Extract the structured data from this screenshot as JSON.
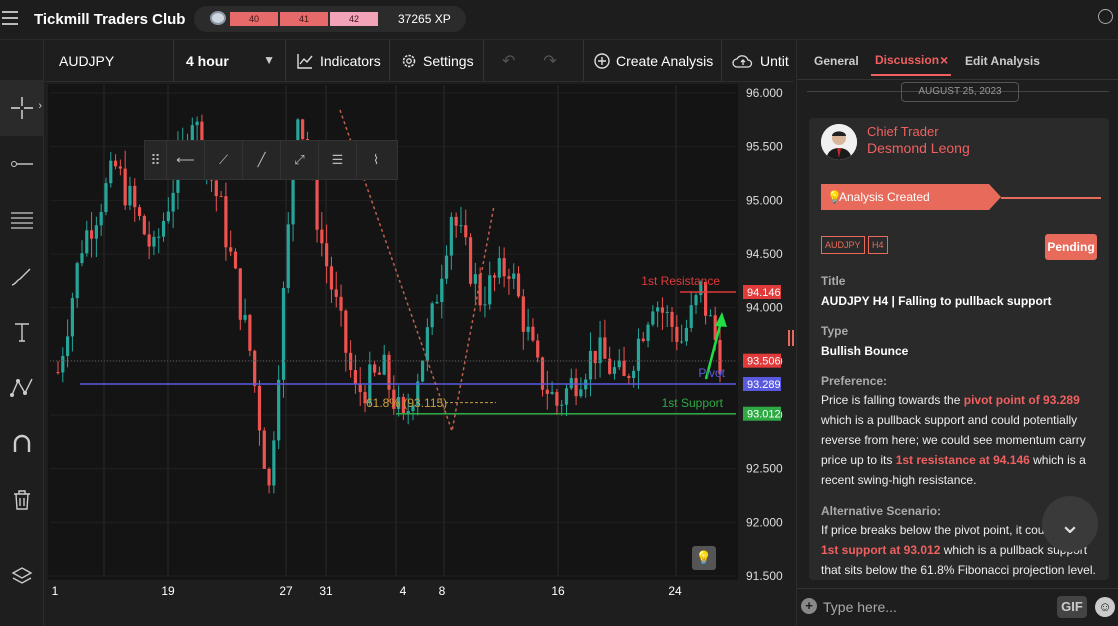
{
  "app": {
    "title": "Tickmill Traders Club"
  },
  "xp": {
    "levels": [
      "40",
      "41",
      "42"
    ],
    "value": "37265 XP"
  },
  "toolbar": {
    "symbol": "AUDJPY",
    "timeframe": "4 hour",
    "indicators": "Indicators",
    "settings": "Settings",
    "create": "Create Analysis",
    "untitled": "Untit"
  },
  "chart": {
    "y_ticks": [
      "96.000",
      "95.500",
      "95.000",
      "94.500",
      "94.000",
      "93.500",
      "93.000",
      "92.500",
      "92.000",
      "91.500"
    ],
    "x_ticks": [
      "1",
      "19",
      "27",
      "31",
      "4",
      "8",
      "16",
      "24"
    ],
    "labels": {
      "resistance": "1st Resistance",
      "pivot": "Pivot",
      "support": "1st Support",
      "fib": "61.8% (93.115)"
    },
    "price_tags": {
      "resistance": "94.146",
      "current": "93.506",
      "pivot": "93.289",
      "support": "93.012"
    },
    "colors": {
      "resistance": "#e03a3a",
      "pivot": "#5a5ae0",
      "support": "#2eaa44",
      "bull": "#26a69a",
      "bear": "#ef5350"
    }
  },
  "chart_data": {
    "type": "candlestick",
    "symbol": "AUDJPY",
    "timeframe": "4 hour",
    "ylim": [
      91.5,
      96.0
    ],
    "levels": {
      "first_resistance": 94.146,
      "pivot": 93.289,
      "first_support": 93.012,
      "fibonacci_61_8": 93.115
    },
    "current_price": 93.506,
    "path": [
      [
        0,
        93.4
      ],
      [
        5,
        94.6
      ],
      [
        12,
        95.3
      ],
      [
        20,
        94.5
      ],
      [
        28,
        95.8
      ],
      [
        34,
        94.9
      ],
      [
        40,
        93.6
      ],
      [
        44,
        92.3
      ],
      [
        50,
        95.9
      ],
      [
        55,
        94.6
      ],
      [
        62,
        93.2
      ],
      [
        68,
        93.4
      ],
      [
        72,
        92.9
      ],
      [
        78,
        93.9
      ],
      [
        82,
        94.9
      ],
      [
        88,
        94.1
      ],
      [
        94,
        94.4
      ],
      [
        100,
        93.4
      ],
      [
        104,
        93.1
      ],
      [
        112,
        93.6
      ],
      [
        118,
        93.3
      ],
      [
        124,
        94.1
      ],
      [
        130,
        93.7
      ],
      [
        134,
        94.15
      ],
      [
        138,
        93.55
      ]
    ]
  },
  "panel": {
    "tabs": [
      "General",
      "Discussion",
      "Edit Analysis"
    ],
    "tab_close": "×",
    "date": "AUGUST 25, 2023",
    "author_role": "Chief Trader",
    "author_name": "Desmond Leong",
    "status_line": "Analysis Created",
    "tags": [
      "AUDJPY",
      "H4"
    ],
    "status": "Pending",
    "title_label": "Title",
    "title": "AUDJPY H4 | Falling to pullback support",
    "type_label": "Type",
    "type": "Bullish Bounce",
    "preference_label": "Preference:",
    "preference_1": "Price is falling towards the ",
    "preference_hl1": "pivot point of 93.289",
    "preference_2": " which is a pullback support and could potentially reverse from here; we could see momentum carry price up to its ",
    "preference_hl2": "1st resistance at 94.146",
    "preference_3": " which is a recent swing-high resistance.",
    "alt_label": "Alternative Scenario:",
    "alt_1": "If price breaks below the pivot point, it cou",
    "alt_hl": "1st support at 93.012",
    "alt_2": " which is a pullback support that sits below the 61.8% Fibonacci projection level.",
    "composer_placeholder": "Type here...",
    "gif": "GIF"
  }
}
